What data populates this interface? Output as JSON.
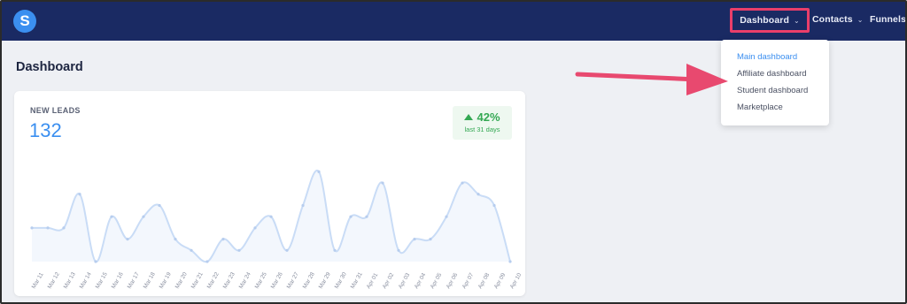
{
  "app": {
    "logo_letter": "S"
  },
  "nav": {
    "dashboard": "Dashboard",
    "contacts": "Contacts",
    "funnels": "Funnels",
    "chevron": "⌄"
  },
  "page": {
    "title": "Dashboard"
  },
  "dropdown": {
    "items": [
      {
        "label": "Main dashboard",
        "active": true
      },
      {
        "label": "Affiliate dashboard",
        "active": false
      },
      {
        "label": "Student dashboard",
        "active": false
      },
      {
        "label": "Marketplace",
        "active": false
      }
    ]
  },
  "card": {
    "label": "NEW LEADS",
    "value": "132",
    "badge": {
      "percent": "42%",
      "subtitle": "last 31 days"
    }
  },
  "colors": {
    "topbar": "#1a2a63",
    "accent": "#3b8ff0",
    "highlight": "#ea3e6a",
    "positive": "#34a853",
    "line": "#c9dcf6"
  },
  "chart_data": {
    "type": "area",
    "categories": [
      "Mar 11",
      "Mar 12",
      "Mar 13",
      "Mar 14",
      "Mar 15",
      "Mar 16",
      "Mar 17",
      "Mar 18",
      "Mar 19",
      "Mar 20",
      "Mar 21",
      "Mar 22",
      "Mar 23",
      "Mar 24",
      "Mar 25",
      "Mar 26",
      "Mar 27",
      "Mar 28",
      "Mar 29",
      "Mar 30",
      "Mar 31",
      "Apr 01",
      "Apr 02",
      "Apr 03",
      "Apr 04",
      "Apr 05",
      "Apr 06",
      "Apr 07",
      "Apr 08",
      "Apr 09",
      "Apr 10"
    ],
    "values": [
      3,
      3,
      3,
      6,
      0,
      4,
      2,
      4,
      5,
      2,
      1,
      0,
      2,
      1,
      3,
      4,
      1,
      5,
      8,
      1,
      4,
      4,
      7,
      1,
      2,
      2,
      4,
      7,
      6,
      5,
      0
    ],
    "ylim": [
      0,
      8.5
    ],
    "grid": false
  }
}
